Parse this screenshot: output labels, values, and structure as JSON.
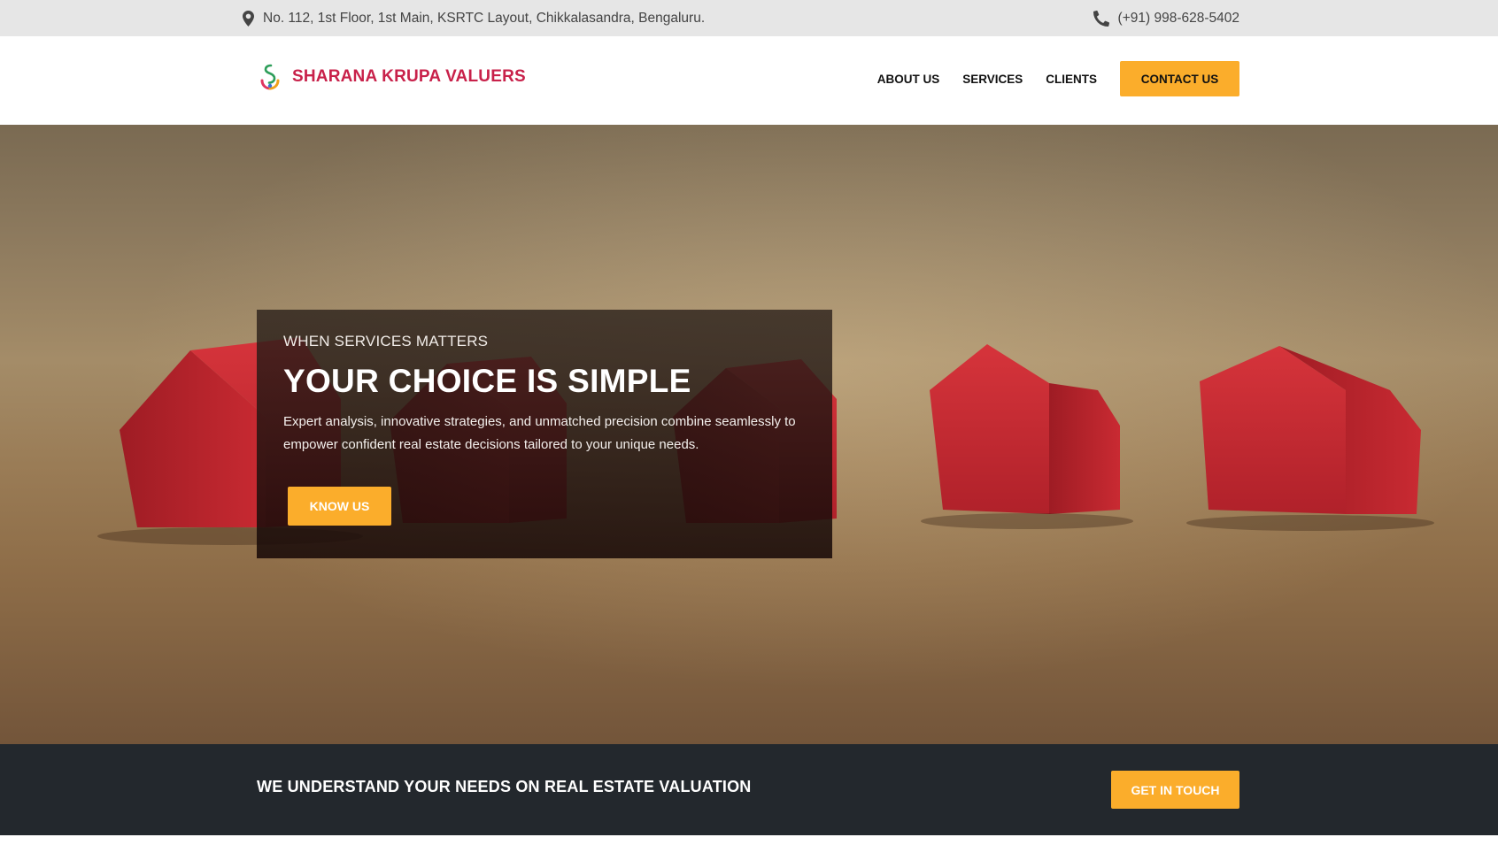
{
  "topbar": {
    "address": "No. 112, 1st Floor, 1st Main, KSRTC Layout, Chikkalasandra, Bengaluru.",
    "address_icon": "map-marker-icon",
    "phone": "(+91) 998-628-5402",
    "phone_icon": "phone-icon"
  },
  "header": {
    "brand_name": "SHARANA KRUPA VALUERS",
    "nav": {
      "about": "ABOUT US",
      "services": "SERVICES",
      "clients": "CLIENTS",
      "contact": "CONTACT US"
    }
  },
  "hero": {
    "eyebrow": "WHEN SERVICES MATTERS",
    "headline": "YOUR CHOICE IS SIMPLE",
    "description": "Expert analysis, innovative strategies, and unmatched precision combine seamlessly to empower confident real estate decisions tailored to your unique needs.",
    "cta": "KNOW US"
  },
  "band": {
    "tagline": "WE UNDERSTAND YOUR NEEDS ON REAL ESTATE VALUATION",
    "cta": "GET IN TOUCH"
  },
  "colors": {
    "brand": "#c8214a",
    "accent": "#fbad2b",
    "topbar_bg": "#e6e6e6",
    "band_bg": "#23282d"
  }
}
